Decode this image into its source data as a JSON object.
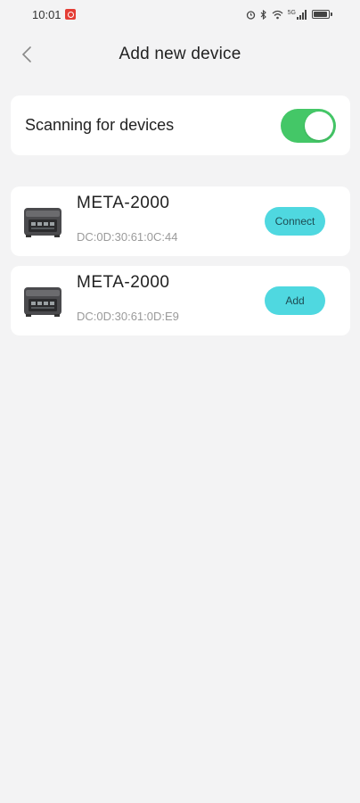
{
  "status_bar": {
    "time": "10:01",
    "network": "5G"
  },
  "header": {
    "title": "Add new device"
  },
  "scan": {
    "label": "Scanning for devices",
    "enabled": true,
    "toggle_color": "#44c767"
  },
  "devices": [
    {
      "name": "META-2000",
      "mac": "DC:0D:30:61:0C:44",
      "action": "Connect"
    },
    {
      "name": "META-2000",
      "mac": "DC:0D:30:61:0D:E9",
      "action": "Add"
    }
  ],
  "colors": {
    "background": "#f3f3f4",
    "card": "#ffffff",
    "action_button": "#4fd8e0",
    "secondary_text": "#9a9a9a"
  },
  "icons": [
    "back-chevron-icon",
    "power-station-icon",
    "alarm-icon",
    "bluetooth-icon",
    "wifi-icon",
    "signal-icon",
    "battery-icon"
  ]
}
